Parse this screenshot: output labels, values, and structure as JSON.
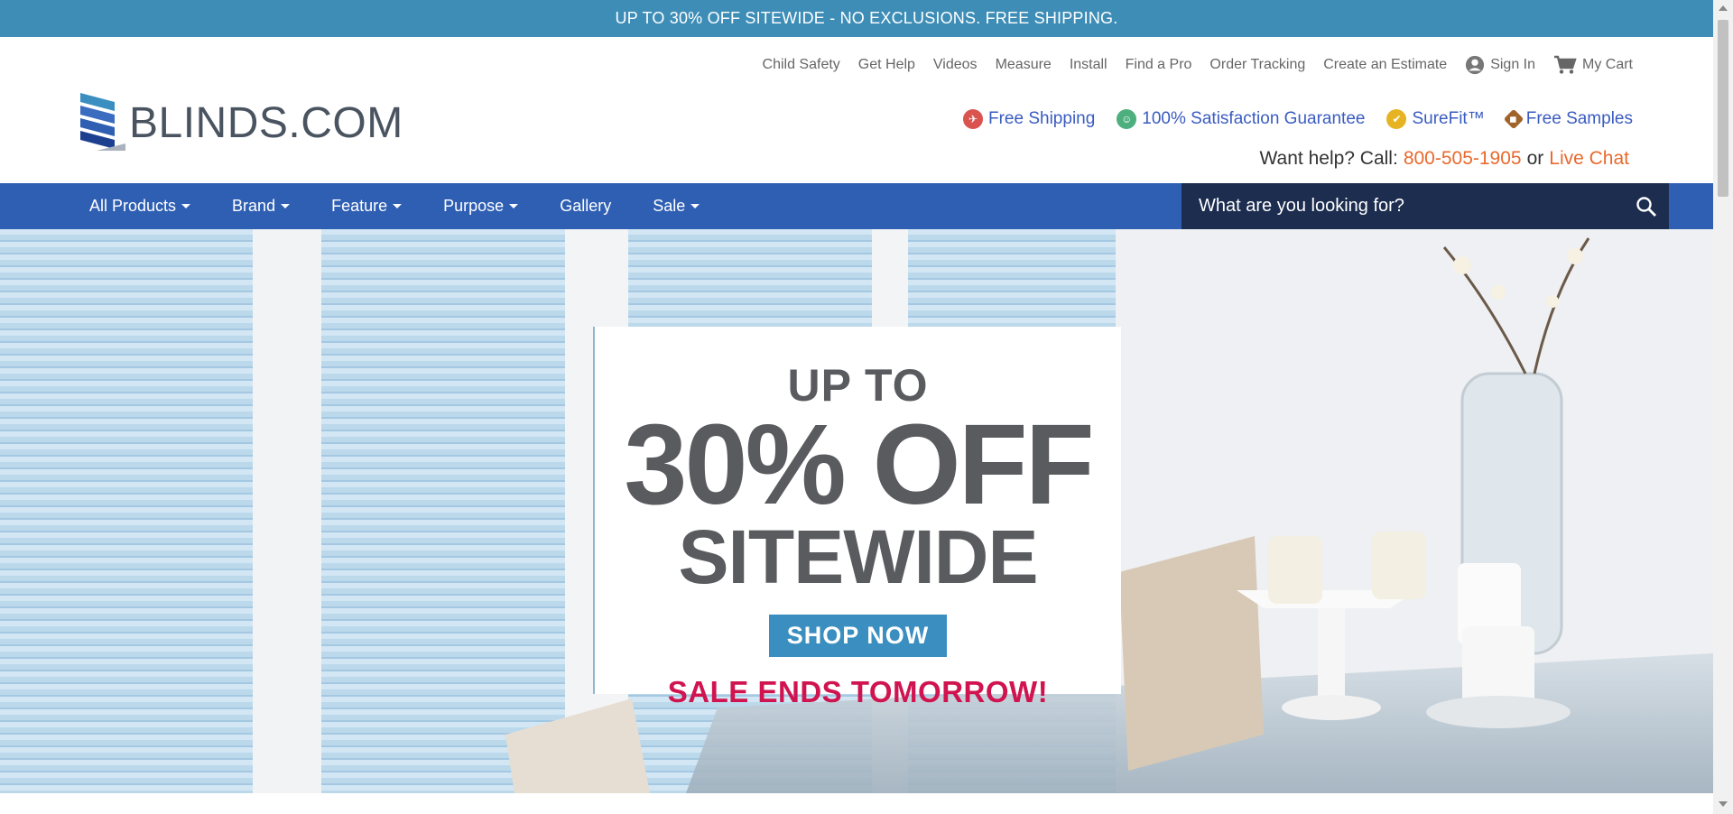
{
  "promo_bar": {
    "text": "UP TO 30% OFF SITEWIDE - NO EXCLUSIONS. FREE SHIPPING."
  },
  "util_nav": {
    "items": [
      "Child Safety",
      "Get Help",
      "Videos",
      "Measure",
      "Install",
      "Find a Pro",
      "Order Tracking",
      "Create an Estimate"
    ],
    "sign_in": "Sign In",
    "cart": "My Cart"
  },
  "logo": {
    "text": "BLINDS.COM"
  },
  "benefits": [
    "Free Shipping",
    "100% Satisfaction Guarantee",
    "SureFit™",
    "Free Samples"
  ],
  "help": {
    "prefix": "Want help? Call:",
    "phone": "800-505-1905",
    "or": "or",
    "chat": "Live Chat"
  },
  "main_nav": {
    "items": [
      {
        "label": "All Products",
        "dropdown": true
      },
      {
        "label": "Brand",
        "dropdown": true
      },
      {
        "label": "Feature",
        "dropdown": true
      },
      {
        "label": "Purpose",
        "dropdown": true
      },
      {
        "label": "Gallery",
        "dropdown": false
      },
      {
        "label": "Sale",
        "dropdown": true
      }
    ]
  },
  "search": {
    "placeholder": "What are you looking for?"
  },
  "hero": {
    "up_to": "UP TO",
    "percent": "30% OFF",
    "sitewide": "SITEWIDE",
    "button": "SHOP NOW",
    "ends": "SALE ENDS TOMORROW!"
  },
  "colors": {
    "promo_bg": "#3d8db7",
    "nav_bg": "#2f5fb3",
    "search_bg": "#1c2d4f",
    "accent": "#e8692c",
    "link": "#3a5cc0",
    "sale_red": "#d0144f"
  }
}
